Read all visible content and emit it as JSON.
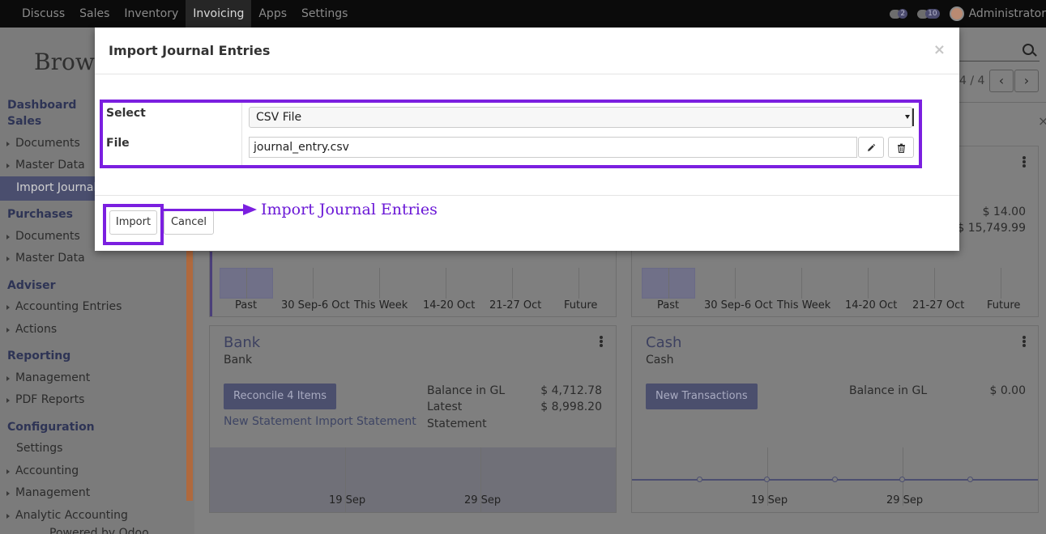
{
  "topnav": {
    "items": [
      "Discuss",
      "Sales",
      "Inventory",
      "Invoicing",
      "Apps",
      "Settings"
    ],
    "active": "Invoicing",
    "chat_count": "2",
    "activity_count": "10",
    "user": "Administrator"
  },
  "backdrop": {
    "brand_partial": "Brows",
    "pager": "4 / 4",
    "sidebar": {
      "sections": [
        {
          "title": "Dashboard Sales",
          "items": [
            "Documents",
            "Master Data",
            "Import Journal"
          ]
        },
        {
          "title": "Purchases",
          "items": [
            "Documents",
            "Master Data"
          ]
        },
        {
          "title": "Adviser",
          "items": [
            "Accounting Entries",
            "Actions"
          ]
        },
        {
          "title": "Reporting",
          "items": [
            "Management",
            "PDF Reports"
          ]
        },
        {
          "title": "Configuration",
          "items": [
            "Settings",
            "Accounting",
            "Management",
            "Analytic Accounting"
          ]
        }
      ],
      "dashboard_line1": "Dashboard",
      "dashboard_line2": "Sales",
      "footer_partial": "Powered by Odoo"
    },
    "top_right_card": {
      "value1": "$ 14.00",
      "value2": "$ 15,749.99"
    },
    "week_labels": [
      "Past",
      "30 Sep-6 Oct",
      "This Week",
      "14-20 Oct",
      "21-27 Oct",
      "Future"
    ],
    "bank_card": {
      "title": "Bank",
      "subtitle": "Bank",
      "button": "Reconcile 4 Items",
      "link": "New Statement Import Statement",
      "balance_label": "Balance in GL",
      "balance_value": "$ 4,712.78",
      "latest_label_1": "Latest",
      "latest_label_2": "Statement",
      "latest_value": "$ 8,998.20",
      "dates": [
        "19 Sep",
        "29 Sep"
      ]
    },
    "cash_card": {
      "title": "Cash",
      "subtitle": "Cash",
      "button": "New Transactions",
      "balance_label": "Balance in GL",
      "balance_value": "$ 0.00",
      "dates": [
        "19 Sep",
        "29 Sep"
      ]
    }
  },
  "modal": {
    "title": "Import Journal Entries",
    "close": "×",
    "select_label": "Select",
    "select_value": "CSV File",
    "file_label": "File",
    "file_value": "journal_entry.csv",
    "import_button": "Import",
    "cancel_button": "Cancel",
    "annotation": "Import Journal Entries",
    "annotation_color": "#7b1fe0"
  }
}
